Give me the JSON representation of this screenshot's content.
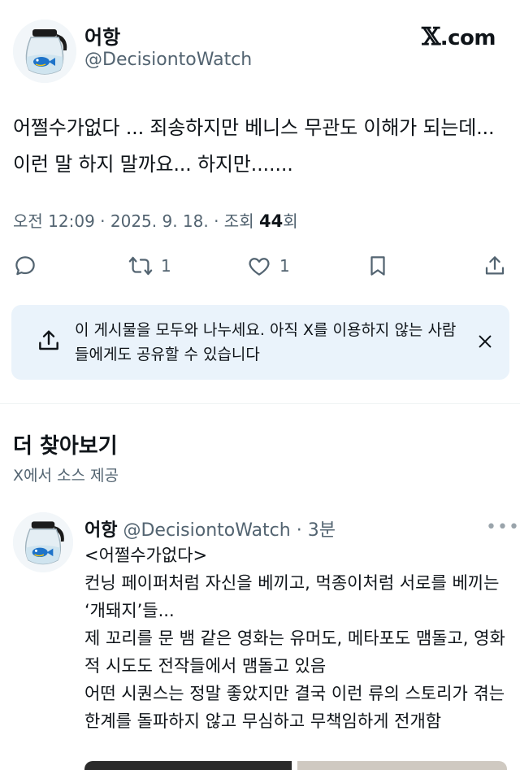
{
  "post": {
    "author_name": "어항",
    "author_handle": "@DecisiontoWatch",
    "brand": "X.com",
    "brand_mark": "𝕏",
    "brand_suffix": ".com",
    "text": "어쩔수가없다 ... 죄송하지만 베니스 무관도 이해가 되는데... 이런 말 하지 말까요... 하지만.......",
    "timestamp": "오전 12:09 · 2025. 9. 18. · 조회 ",
    "views": "44",
    "views_suffix": "회"
  },
  "actions": {
    "reply_icon": "reply-icon",
    "repost_icon": "repost-icon",
    "repost_count": "1",
    "like_icon": "heart-icon",
    "like_count": "1",
    "bookmark_icon": "bookmark-icon",
    "share_icon": "share-icon"
  },
  "share_banner": {
    "text": "이 게시물을 모두와 나누세요. 아직 X를 이용하지 않는 사람들에게도 공유할 수 있습니다",
    "close_icon": "close-icon"
  },
  "more": {
    "title": "더 찾아보기",
    "source": "X에서 소스 제공"
  },
  "related_post": {
    "author_name": "어항",
    "author_handle": "@DecisiontoWatch",
    "time_sep": " · ",
    "time": "3분",
    "more_icon": "more-dots-icon",
    "text": "<어쩔수가없다>\n컨닝 페이퍼처럼 자신을 베끼고, 먹종이처럼 서로를 베끼는 ‘개돼지’들...\n제 꼬리를 문 뱀 같은 영화는 유머도, 메타포도 맴돌고, 영화적 시도도 전작들에서 맴돌고 있음\n어떤 시퀀스는 정말 좋았지만 결국 이런 류의 스토리가 겪는 한계를 돌파하지 않고 무심하고 무책임하게 전개함"
  },
  "colors": {
    "text": "#0f1419",
    "secondary": "#536471",
    "banner_bg": "#eaf3fb",
    "avatar_bg": "#f2f6f9"
  }
}
